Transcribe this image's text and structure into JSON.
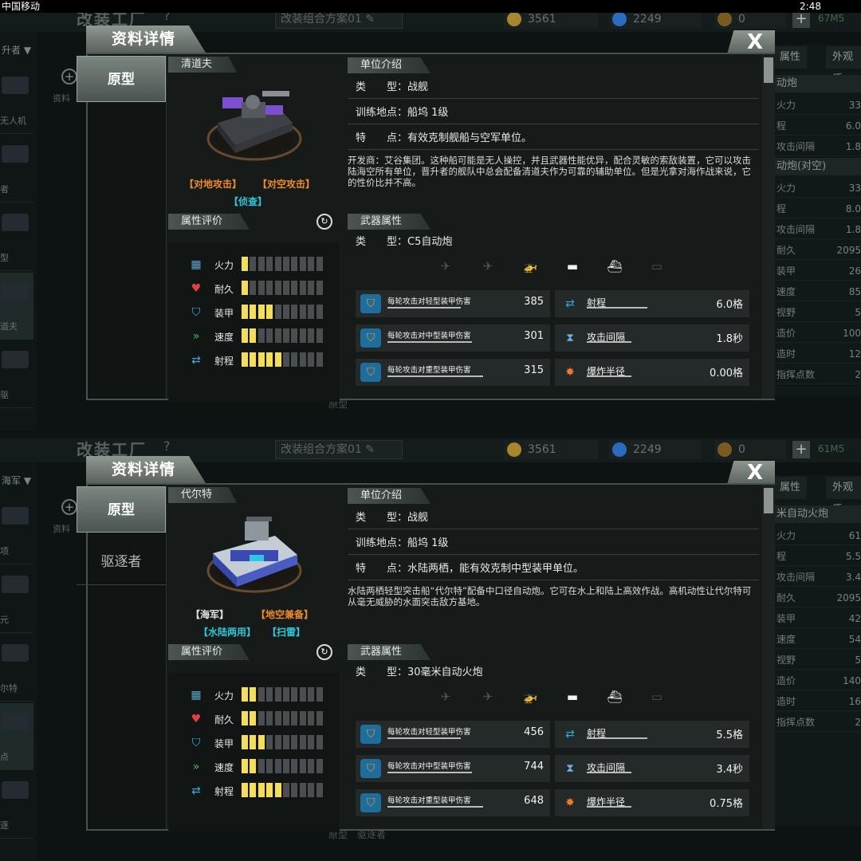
{
  "screens": [
    {
      "statusbar": {
        "carrier": "中国移动",
        "time": "2:48"
      },
      "bg": {
        "title": "改装工厂",
        "help": "?",
        "plan": "改装组合方案01 ✎",
        "coins": "3561",
        "gems": "2249",
        "tickets": "0",
        "memory": "67M5",
        "left_dropdown": "升者 ▼",
        "left_items": [
          "无人机",
          "者",
          "型",
          "道夫",
          "驱"
        ],
        "add_label": "资料",
        "right_tabs": [
          "属性",
          "外观质"
        ],
        "right_sections": [
          {
            "title": "动炮",
            "rows": [
              [
                "火力",
                "33"
              ],
              [
                "程",
                "6.0"
              ],
              [
                "攻击间隔",
                "1.8"
              ]
            ]
          },
          {
            "title": "动炮(对空)",
            "rows": [
              [
                "火力",
                "33"
              ],
              [
                "程",
                "8.0"
              ],
              [
                "攻击间隔",
                "1.8"
              ]
            ]
          },
          {
            "title": "",
            "rows": [
              [
                "耐久",
                "2095"
              ],
              [
                "装甲",
                "26"
              ],
              [
                "速度",
                "85"
              ],
              [
                "视野",
                "5"
              ],
              [
                "造价",
                "100"
              ],
              [
                "造时",
                "12"
              ],
              [
                "指挥点数",
                "2"
              ]
            ]
          }
        ],
        "bottom_label": "原型"
      },
      "modal": {
        "title": "资料详情",
        "close": "X",
        "side_tabs": [
          "原型"
        ],
        "unit_name": "清道夫",
        "tags_row1": [
          {
            "text": "【对地攻击】",
            "color": "or"
          },
          {
            "text": "【对空攻击】",
            "color": "or"
          }
        ],
        "tags_row2": [
          {
            "text": "【侦查】",
            "color": "cy"
          }
        ],
        "attr_header": "属性评价",
        "attrs": [
          {
            "name": "火力",
            "value": 1,
            "icon": "firepower-icon",
            "glyph": "▦",
            "color": "#5fa8c8"
          },
          {
            "name": "耐久",
            "value": 1,
            "icon": "heart-icon",
            "glyph": "♥",
            "color": "#e04040"
          },
          {
            "name": "装甲",
            "value": 4,
            "icon": "armor-shield-icon",
            "glyph": "⛉",
            "color": "#38b6e0"
          },
          {
            "name": "速度",
            "value": 2,
            "icon": "speed-chevron-icon",
            "glyph": "»",
            "color": "#3ec04e"
          },
          {
            "name": "射程",
            "value": 5,
            "icon": "range-arrow-icon",
            "glyph": "⇄",
            "color": "#3aa8e0"
          }
        ],
        "intro_header": "单位介绍",
        "info_rows": [
          {
            "k": "类　　型：",
            "v": "战舰"
          },
          {
            "k": "训练地点：",
            "v": "船坞 1级"
          },
          {
            "k": "特　　点：",
            "v": "有效克制舰船与空军单位。"
          }
        ],
        "description": "开发商：艾谷集团。这种船可能是无人操控，并且武器性能优异，配合灵敏的索敌装置，它可以攻击陆海空所有单位，晋升者的舰队中总会配备清道夫作为可靠的辅助单位。但是光拿对海作战来说，它的性价比并不高。",
        "weapon_header": "武器属性",
        "weapon_type": "类　　型：C5自动炮",
        "targets": [
          {
            "icon": "aircraft-icon",
            "glyph": "✈",
            "on": false
          },
          {
            "icon": "jet-icon",
            "glyph": "✈",
            "on": false
          },
          {
            "icon": "helicopter-icon",
            "glyph": "🚁",
            "on": true
          },
          {
            "icon": "tank-icon",
            "glyph": "▬",
            "on": true
          },
          {
            "icon": "ship-icon",
            "glyph": "⛴",
            "on": true
          },
          {
            "icon": "submarine-icon",
            "glyph": "▭",
            "on": false
          }
        ],
        "stats_left": [
          {
            "label": "每轮攻击对轻型装甲伤害",
            "value": "385",
            "icon": "light-armor-icon"
          },
          {
            "label": "每轮攻击对中型装甲伤害",
            "value": "301",
            "icon": "medium-armor-icon"
          },
          {
            "label": "每轮攻击对重型装甲伤害",
            "value": "315",
            "icon": "heavy-armor-icon"
          }
        ],
        "stats_right": [
          {
            "label": "射程",
            "value": "6.0格",
            "icon": "range-icon"
          },
          {
            "label": "攻击间隔",
            "value": "1.8秒",
            "icon": "hourglass-icon"
          },
          {
            "label": "爆炸半径",
            "value": "0.00格",
            "icon": "explosion-icon"
          }
        ]
      }
    },
    {
      "statusbar": {
        "carrier": "",
        "time": ""
      },
      "bg": {
        "title": "改装工厂",
        "help": "?",
        "plan": "改装组合方案01 ✎",
        "coins": "3561",
        "gems": "2249",
        "tickets": "0",
        "memory": "61M5",
        "left_dropdown": "海军 ▼",
        "left_items": [
          "项",
          "元",
          "尔特",
          "点",
          "逐"
        ],
        "add_label": "资料",
        "right_tabs": [
          "属性",
          "外观质"
        ],
        "right_sections": [
          {
            "title": "米自动火炮",
            "rows": [
              [
                "火力",
                "61"
              ],
              [
                "程",
                "5.5"
              ],
              [
                "攻击间隔",
                "3.4"
              ]
            ]
          },
          {
            "title": "",
            "rows": [
              [
                "耐久",
                "2095"
              ],
              [
                "装甲",
                "42"
              ],
              [
                "速度",
                "54"
              ],
              [
                "视野",
                "5"
              ],
              [
                "造价",
                "140"
              ],
              [
                "造时",
                "16"
              ],
              [
                "指挥点数",
                "2"
              ]
            ]
          }
        ],
        "bottom_label": "原型　驱逐者"
      },
      "modal": {
        "title": "资料详情",
        "close": "X",
        "side_tabs": [
          "原型",
          "驱逐者"
        ],
        "unit_name": "代尔特",
        "tags_row1": [
          {
            "text": "【海军】",
            "color": "wh"
          },
          {
            "text": "【地空兼备】",
            "color": "or"
          }
        ],
        "tags_row2": [
          {
            "text": "【水陆两用】",
            "color": "cy"
          },
          {
            "text": "【扫雷】",
            "color": "cy"
          }
        ],
        "attr_header": "属性评价",
        "attrs": [
          {
            "name": "火力",
            "value": 2,
            "icon": "firepower-icon",
            "glyph": "▦",
            "color": "#5fa8c8"
          },
          {
            "name": "耐久",
            "value": 2,
            "icon": "heart-icon",
            "glyph": "♥",
            "color": "#e04040"
          },
          {
            "name": "装甲",
            "value": 3,
            "icon": "armor-shield-icon",
            "glyph": "⛉",
            "color": "#38b6e0"
          },
          {
            "name": "速度",
            "value": 2,
            "icon": "speed-chevron-icon",
            "glyph": "»",
            "color": "#3ec04e"
          },
          {
            "name": "射程",
            "value": 5,
            "icon": "range-arrow-icon",
            "glyph": "⇄",
            "color": "#3aa8e0"
          }
        ],
        "intro_header": "单位介绍",
        "info_rows": [
          {
            "k": "类　　型：",
            "v": "战舰"
          },
          {
            "k": "训练地点：",
            "v": "船坞 1级"
          },
          {
            "k": "特　　点：",
            "v": "水陆两栖，能有效克制中型装甲单位。"
          }
        ],
        "description": "水陆两栖轻型突击船“代尔特”配备中口径自动炮。它可在水上和陆上高效作战。高机动性让代尔特可从毫无威胁的水面突击敌方基地。",
        "weapon_header": "武器属性",
        "weapon_type": "类　　型：30毫米自动火炮",
        "targets": [
          {
            "icon": "aircraft-icon",
            "glyph": "✈",
            "on": false
          },
          {
            "icon": "jet-icon",
            "glyph": "✈",
            "on": false
          },
          {
            "icon": "helicopter-icon",
            "glyph": "🚁",
            "on": true
          },
          {
            "icon": "tank-icon",
            "glyph": "▬",
            "on": true
          },
          {
            "icon": "ship-icon",
            "glyph": "⛴",
            "on": true
          },
          {
            "icon": "submarine-icon",
            "glyph": "▭",
            "on": false
          }
        ],
        "stats_left": [
          {
            "label": "每轮攻击对轻型装甲伤害",
            "value": "456",
            "icon": "light-armor-icon"
          },
          {
            "label": "每轮攻击对中型装甲伤害",
            "value": "744",
            "icon": "medium-armor-icon"
          },
          {
            "label": "每轮攻击对重型装甲伤害",
            "value": "648",
            "icon": "heavy-armor-icon"
          }
        ],
        "stats_right": [
          {
            "label": "射程",
            "value": "5.5格",
            "icon": "range-icon"
          },
          {
            "label": "攻击间隔",
            "value": "3.4秒",
            "icon": "hourglass-icon"
          },
          {
            "label": "爆炸半径",
            "value": "0.75格",
            "icon": "explosion-icon"
          }
        ]
      }
    }
  ]
}
